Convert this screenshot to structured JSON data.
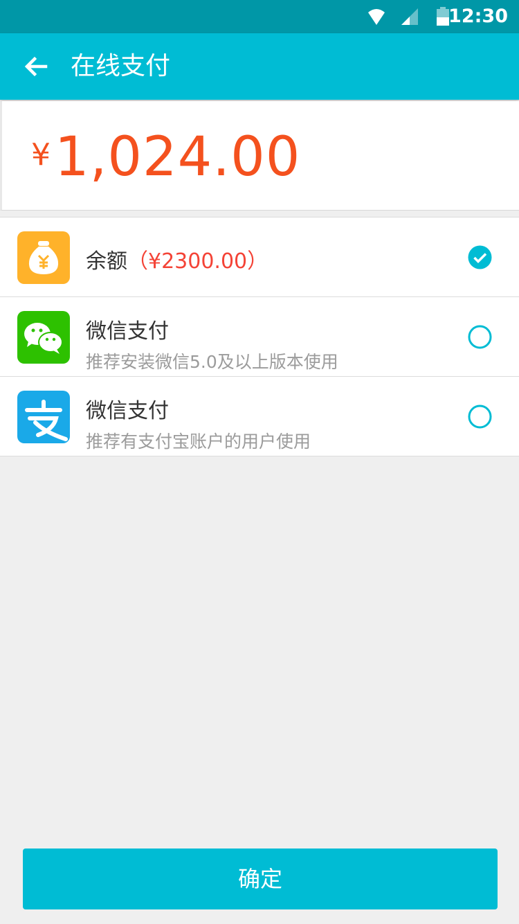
{
  "status_bar": {
    "time": "12:30",
    "icons": [
      "wifi-icon",
      "signal-icon",
      "battery-icon"
    ]
  },
  "app_bar": {
    "title": "在线支付",
    "back_icon": "arrow-back-icon"
  },
  "amount": {
    "currency": "¥",
    "value": "1,024.00"
  },
  "payment_methods": [
    {
      "name": "余额",
      "balance": "（¥2300.00）",
      "subtitle": "",
      "icon": "money-bag-icon",
      "icon_color": "#ffb22a",
      "selected": true
    },
    {
      "name": "微信支付",
      "subtitle": "推荐安装微信5.0及以上版本使用",
      "icon": "wechat-icon",
      "icon_color": "#2dc100",
      "selected": false
    },
    {
      "name": "微信支付",
      "subtitle": "推荐有支付宝账户的用户使用",
      "icon": "alipay-icon",
      "icon_color": "#1aa9e8",
      "selected": false
    }
  ],
  "confirm_label": "确定",
  "colors": {
    "primary": "#00bcd4",
    "primary_dark": "#0097a7",
    "amount": "#f4511e",
    "balance": "#f44336"
  }
}
